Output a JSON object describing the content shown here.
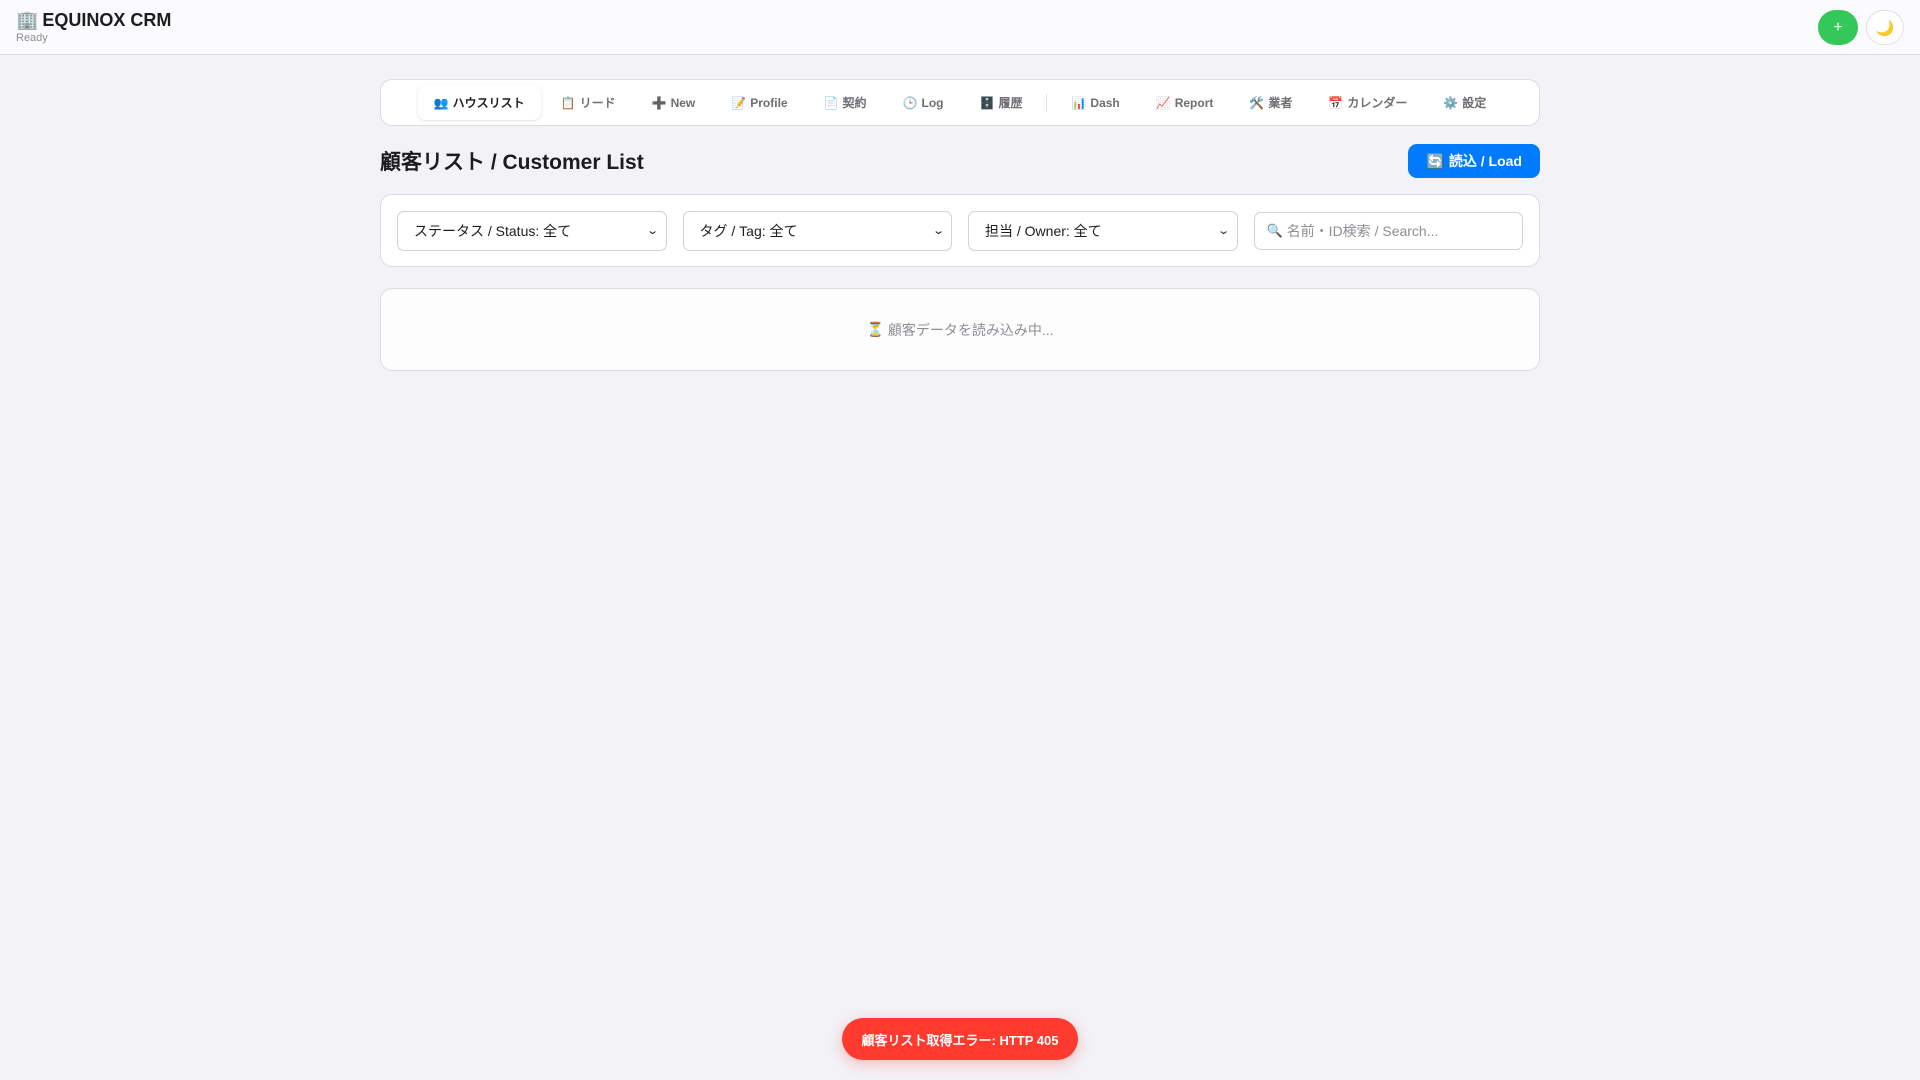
{
  "header": {
    "brand_icon": "🏢",
    "title": "EQUINOX CRM",
    "status": "Ready",
    "add_label": "+",
    "theme_icon": "🌙"
  },
  "tabs": [
    {
      "icon": "👥",
      "label": "ハウスリスト",
      "active": true
    },
    {
      "icon": "📋",
      "label": "リード"
    },
    {
      "icon": "➕",
      "label": "New"
    },
    {
      "icon": "📝",
      "label": "Profile"
    },
    {
      "icon": "📄",
      "label": "契約"
    },
    {
      "icon": "🕒",
      "label": "Log"
    },
    {
      "icon": "🗄️",
      "label": "履歴"
    },
    {
      "icon": "📊",
      "label": "Dash"
    },
    {
      "icon": "📈",
      "label": "Report"
    },
    {
      "icon": "🛠️",
      "label": "業者"
    },
    {
      "icon": "📅",
      "label": "カレンダー"
    },
    {
      "icon": "⚙️",
      "label": "設定"
    }
  ],
  "page": {
    "title": "顧客リスト / Customer List",
    "load_icon": "🔄",
    "load_label": "読込 / Load"
  },
  "filters": {
    "status": "ステータス / Status: 全て",
    "tag": "タグ / Tag: 全て",
    "owner": "担当 / Owner: 全て",
    "search_icon": "🔍",
    "search_placeholder": "名前・ID検索 / Search..."
  },
  "results": {
    "loading_icon": "⏳",
    "loading_text": "顧客データを読み込み中..."
  },
  "toast": {
    "message": "顧客リスト取得エラー: HTTP 405"
  },
  "colors": {
    "primary": "#007aff",
    "success": "#34c759",
    "danger": "#ff3b30",
    "background": "#f2f2f7"
  }
}
